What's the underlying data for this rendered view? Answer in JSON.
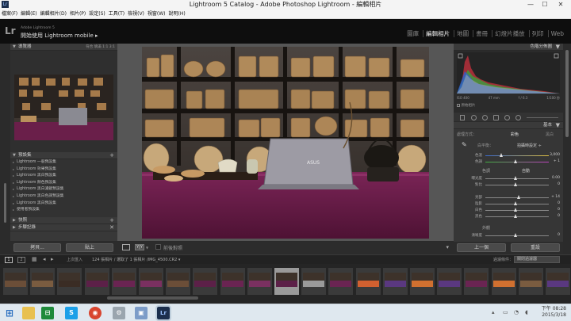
{
  "window": {
    "title": "Lightroom 5 Catalog - Adobe Photoshop Lightroom - 編輯相片",
    "minimize": "—",
    "maximize": "☐",
    "close": "✕"
  },
  "menu": [
    "檔案(F)",
    "編輯(E)",
    "編輯相片(D)",
    "相片(P)",
    "設定(S)",
    "工具(T)",
    "檢視(V)",
    "視窗(W)",
    "說明(H)"
  ],
  "identity": {
    "logo": "Lr",
    "product": "Adobe Lightroom 5",
    "tagline": "開始使用 Lightroom mobile ▸"
  },
  "modules": [
    {
      "label": "圖庫",
      "active": false
    },
    {
      "label": "編輯相片",
      "active": true
    },
    {
      "label": "地圖",
      "active": false
    },
    {
      "label": "書冊",
      "active": false
    },
    {
      "label": "幻燈片播放",
      "active": false
    },
    {
      "label": "列印",
      "active": false
    },
    {
      "label": "Web",
      "active": false
    }
  ],
  "left": {
    "navigator": {
      "title": "導覽器",
      "zoom": "符合  填滿  1:1  3:1"
    },
    "presets": {
      "title": "預設集",
      "items": [
        "Lightroom 一般預設集",
        "Lightroom 效果預設集",
        "Lightroom 黑白預設集",
        "Lightroom 顏色預設集",
        "Lightroom 黑白濾鏡預設集",
        "Lightroom 黑白色調預設集",
        "Lightroom 黑白預設集",
        "使用者預設集"
      ]
    },
    "snapshots": {
      "title": "快照"
    },
    "history": {
      "title": "步驟記錄"
    },
    "copy_button": "拷貝...",
    "paste_button": "貼上"
  },
  "toolbar": {
    "before_after": "前後對照",
    "filter_label": "過濾條件：",
    "filter_value": "關閉過濾器"
  },
  "right": {
    "histogram": {
      "title": "色階分佈圖",
      "iso": "ISO 400",
      "focal": "47 mm",
      "aperture": "f / 6.3",
      "shutter": "1/100 秒",
      "original": "原始相片"
    },
    "basic": {
      "title": "基本",
      "treatment_label": "處理方式：",
      "color": "彩色",
      "bw": "黑白",
      "wb_label": "白平衡：",
      "wb_value": "拍攝時設定 ÷",
      "temp_label": "色溫",
      "temp_value": "3,000",
      "tint_label": "色調",
      "tint_value": "+ 1",
      "tone_label": "色調",
      "auto": "自動",
      "exposure_label": "曝光度",
      "exposure_value": "0.00",
      "contrast_label": "對比",
      "contrast_value": "0",
      "highlights_label": "亮部",
      "highlights_value": "+ 14",
      "shadows_label": "陰影",
      "shadows_value": "0",
      "whites_label": "白色",
      "whites_value": "0",
      "blacks_label": "黑色",
      "blacks_value": "0",
      "presence_label": "外觀",
      "clarity_label": "清晰度",
      "clarity_value": "0"
    },
    "prev_button": "上一個",
    "reset_button": "重設"
  },
  "filmbar": {
    "page1": "1",
    "page2": "2",
    "source": "上次匯入",
    "count": "124 張相片 / 選取了 1 張相片 /IMG_4500.CR2 ▾"
  },
  "taskbar": {
    "time": "下午 08:28",
    "date": "2015/3/18"
  }
}
